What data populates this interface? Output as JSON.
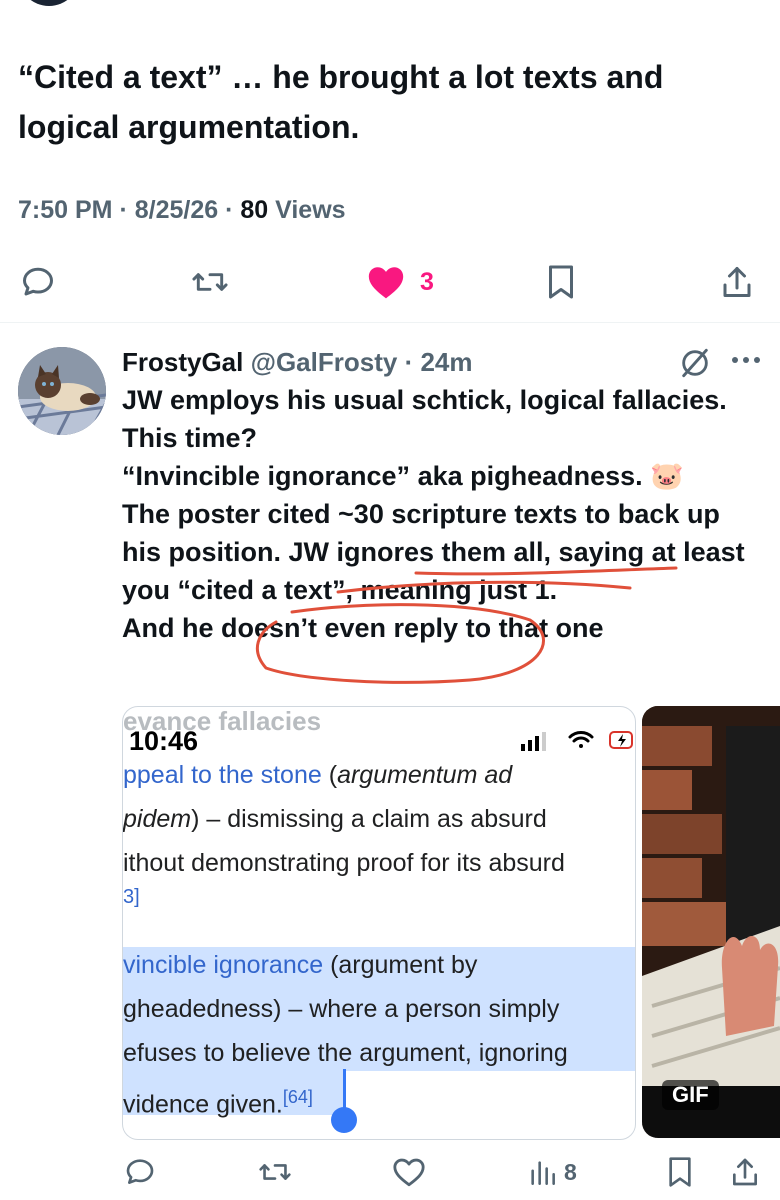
{
  "main_tweet": {
    "text": "“Cited a text” … he brought a lot texts and logical argumentation.",
    "time": "7:50 PM",
    "date": "8/25/26",
    "views_count": "80",
    "views_label": "Views",
    "likes": "3"
  },
  "reply": {
    "name": "FrostyGal",
    "handle": "@GalFrosty",
    "time": "24m",
    "body": "JW employs his usual schtick, logical fallacies.\nThis time?\n“Invincible ignorance” aka pigheadness. 🐷\nThe poster cited ~30 scripture texts to back up his position. JW ignores them all, saying at least you “cited a text”, meaning just 1.\nAnd he doesn’t even reply to that one",
    "views": "8"
  },
  "screenshot": {
    "heading_fragment": "evance fallacies",
    "clock": "10:46",
    "line1_link": "ppeal to the stone",
    "line1_rest": " (",
    "line1_italic": "argumentum ad",
    "line2_italic": "pidem",
    "line2_rest": ") – dismissing a claim as absurd",
    "line3": "ithout demonstrating proof for its absurd",
    "line4_ref": "3]",
    "line5_link": "vincible ignorance",
    "line5_rest": " (argument by",
    "line6": "gheadedness) – where a person simply",
    "line7": "efuses to believe the argument, ignoring",
    "line8": "vidence given.",
    "line8_ref": "[64]"
  },
  "gif_badge": "GIF",
  "colors": {
    "like": "#f91880",
    "link": "#3366cc",
    "scribble": "#e0503a",
    "highlight": "#cfe2ff",
    "muted": "#536471"
  }
}
